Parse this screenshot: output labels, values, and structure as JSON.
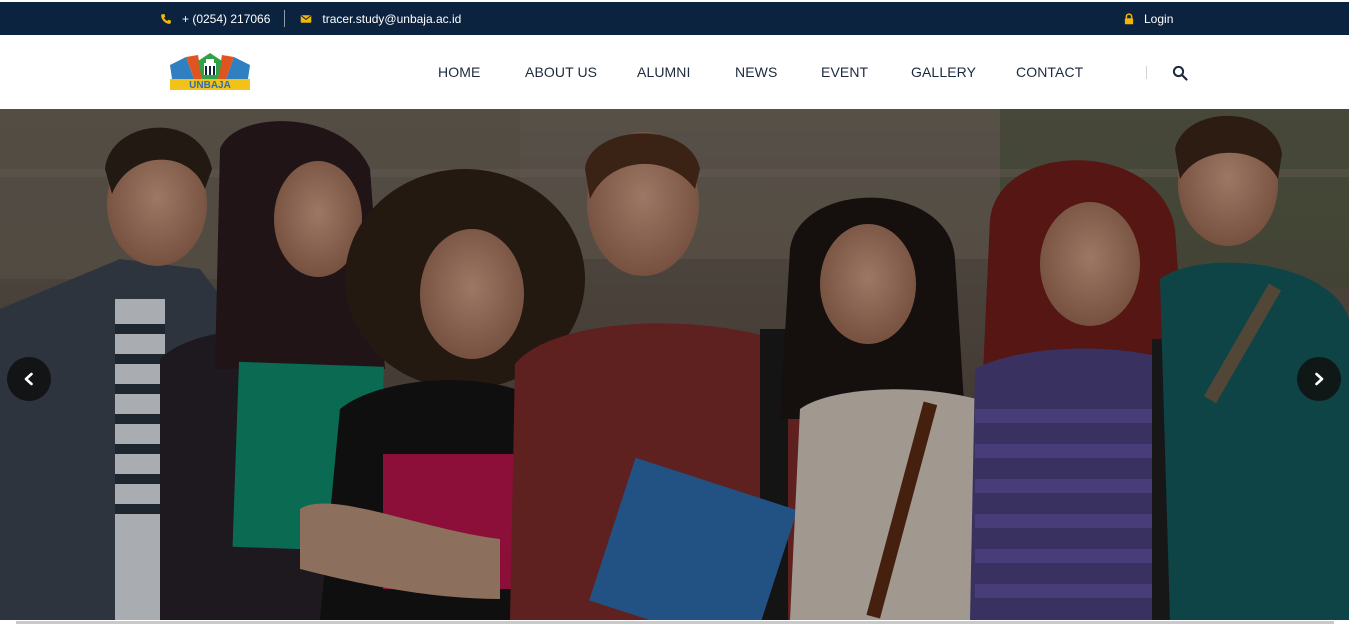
{
  "topbar": {
    "phone": "+ (0254) 217066",
    "phone_icon": "phone-icon",
    "email": "tracer.study@unbaja.ac.id",
    "email_icon": "envelope-icon",
    "login_label": "Login",
    "login_icon": "lock-icon",
    "background": "#0c2340",
    "icon_color": "#f2b705"
  },
  "header": {
    "logo_text": "UNBAJA",
    "nav": [
      {
        "label": "HOME"
      },
      {
        "label": "ABOUT US"
      },
      {
        "label": "ALUMNI"
      },
      {
        "label": "NEWS"
      },
      {
        "label": "EVENT"
      },
      {
        "label": "GALLERY"
      },
      {
        "label": "CONTACT"
      }
    ],
    "search_icon": "search-icon"
  },
  "hero": {
    "image_subject": "group of smiling students holding folders",
    "prev_icon": "chevron-left-icon",
    "next_icon": "chevron-right-icon"
  }
}
